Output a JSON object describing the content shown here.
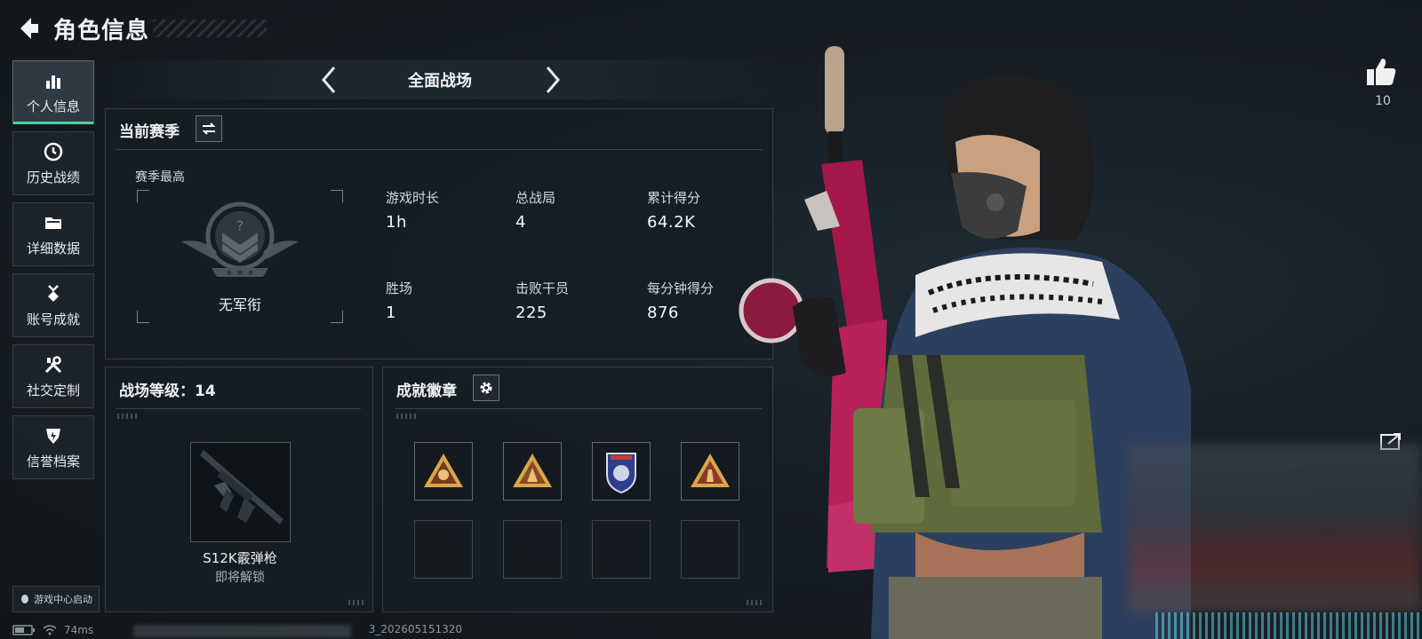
{
  "header": {
    "title": "角色信息"
  },
  "sidebar": {
    "items": [
      {
        "label": "个人信息",
        "icon": "bar-chart-icon",
        "active": true
      },
      {
        "label": "历史战绩",
        "icon": "clock-history-icon",
        "active": false
      },
      {
        "label": "详细数据",
        "icon": "folder-icon",
        "active": false
      },
      {
        "label": "账号成就",
        "icon": "medal-icon",
        "active": false
      },
      {
        "label": "社交定制",
        "icon": "tools-icon",
        "active": false
      },
      {
        "label": "信誉档案",
        "icon": "shield-badge-icon",
        "active": false
      }
    ],
    "game_center": "游戏中心启动"
  },
  "mode": {
    "title": "全面战场"
  },
  "season": {
    "title": "当前赛季",
    "best_label": "赛季最高",
    "rank_name": "无军衔",
    "stats": [
      {
        "label": "游戏时长",
        "value": "1h"
      },
      {
        "label": "总战局",
        "value": "4"
      },
      {
        "label": "累计得分",
        "value": "64.2K"
      },
      {
        "label": "胜场",
        "value": "1"
      },
      {
        "label": "击败干员",
        "value": "225"
      },
      {
        "label": "每分钟得分",
        "value": "876"
      }
    ]
  },
  "level": {
    "title": "战场等级：14",
    "weapon_name": "S12K霰弹枪",
    "weapon_status": "即将解锁"
  },
  "badges": {
    "title": "成就徽章",
    "slots": [
      {
        "icon": "skull-triangle-badge-icon",
        "filled": true
      },
      {
        "icon": "soldier-triangle-badge-icon",
        "filled": true
      },
      {
        "icon": "lion-shield-badge-icon",
        "filled": true
      },
      {
        "icon": "hand-triangle-badge-icon",
        "filled": true
      },
      {
        "filled": false
      },
      {
        "filled": false
      },
      {
        "filled": false
      },
      {
        "filled": false
      }
    ]
  },
  "social": {
    "likes": "10"
  },
  "status": {
    "ping": "74ms",
    "build": "3_202605151320"
  },
  "colors": {
    "accent": "#4fd0a6",
    "panel_bg": "#161e24",
    "text": "#e6e9eb",
    "badge_gold": "#d9a64a"
  }
}
